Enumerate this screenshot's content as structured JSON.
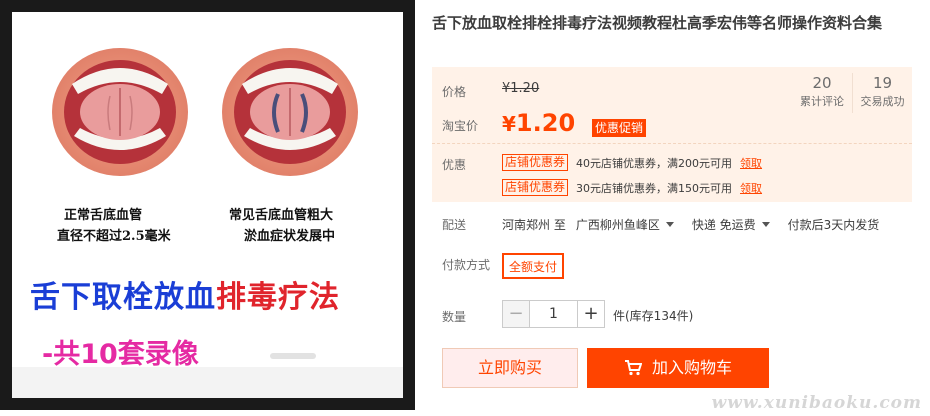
{
  "product_image": {
    "caption_left_line1": "正常舌底血管",
    "caption_left_line2": "直径不超过2.5毫米",
    "caption_right_line1": "常见舌底血管粗大",
    "caption_right_line2": "淤血症状发展中",
    "banner_blue": "舌下取栓放血",
    "banner_red": "排毒疗法",
    "banner_pink": "-共10套录像",
    "colors": {
      "banner_blue": "#1a3ed6",
      "banner_red": "#e0242c",
      "banner_pink": "#e52aa3"
    }
  },
  "title": "舌下放血取栓排栓排毒疗法视频教程杜高季宏伟等名师操作资料合集",
  "price": {
    "price_label": "价格",
    "original": "¥1.20",
    "taobao_label": "淘宝价",
    "currency": "¥",
    "amount": "1.20",
    "promo_badge": "优惠促销"
  },
  "stats": [
    {
      "num": "20",
      "label": "累计评论"
    },
    {
      "num": "19",
      "label": "交易成功"
    }
  ],
  "coupons": {
    "label": "优惠",
    "items": [
      {
        "tag": "店铺优惠券",
        "desc": "40元店铺优惠券，满200元可用",
        "link": "领取"
      },
      {
        "tag": "店铺优惠券",
        "desc": "30元店铺优惠券，满150元可用",
        "link": "领取"
      }
    ]
  },
  "shipping": {
    "label": "配送",
    "from": "河南郑州 至",
    "to": "广西柳州鱼峰区",
    "method": "快递 免运费",
    "dispatch": "付款后3天内发货"
  },
  "payment": {
    "label": "付款方式",
    "option": "全额支付"
  },
  "quantity": {
    "label": "数量",
    "minus": "−",
    "value": "1",
    "plus": "+",
    "stock": "件(库存134件)"
  },
  "actions": {
    "buy": "立即购买",
    "cart": "加入购物车"
  },
  "watermark": "www.xunibaoku.com",
  "colors": {
    "accent": "#ff4400",
    "price_bg": "#fff2e8"
  }
}
